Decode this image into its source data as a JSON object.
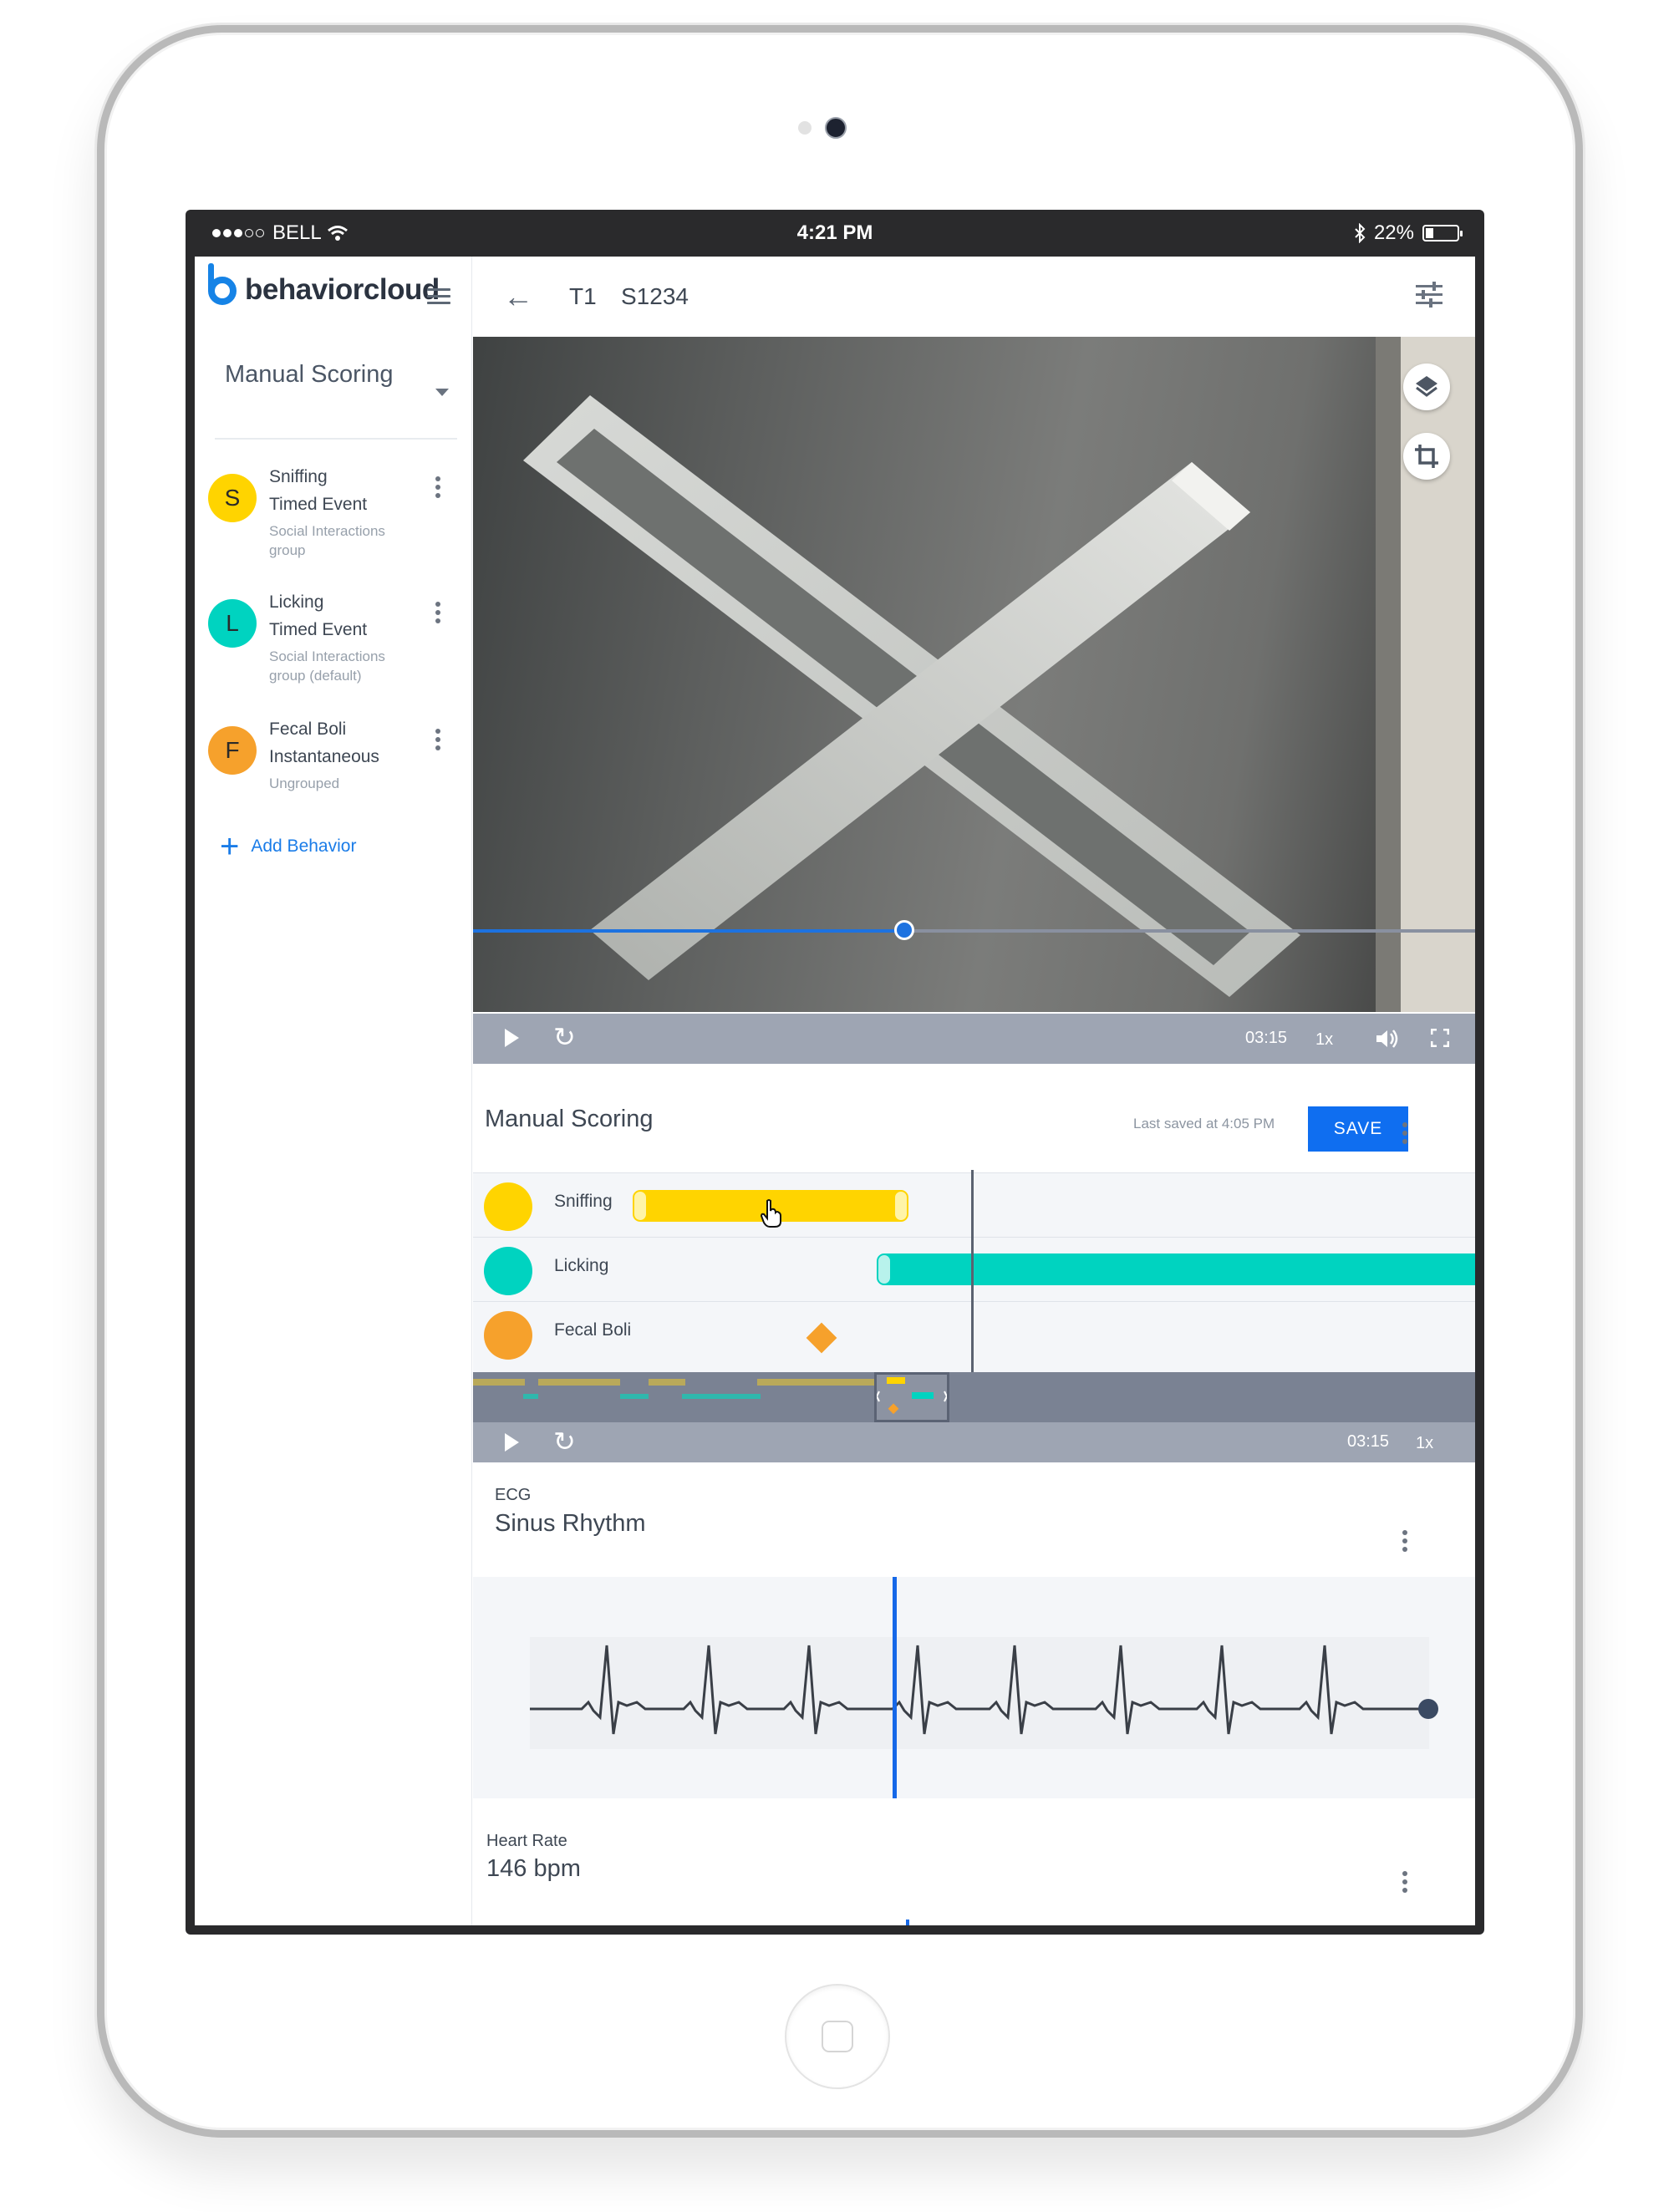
{
  "statusbar": {
    "carrier": "BELL",
    "time": "4:21 PM",
    "battery": "22%"
  },
  "sidebar": {
    "brand": "behaviorcloud",
    "section_title": "Manual Scoring",
    "behaviors": [
      {
        "initial": "S",
        "name": "Sniffing",
        "type": "Timed Event",
        "group": "Social Interactions group",
        "color": "#FFD400"
      },
      {
        "initial": "L",
        "name": "Licking",
        "type": "Timed Event",
        "group": "Social Interactions group (default)",
        "color": "#00D3C0"
      },
      {
        "initial": "F",
        "name": "Fecal Boli",
        "type": "Instantaneous",
        "group": "Ungrouped",
        "color": "#F6A12C"
      }
    ],
    "add_label": "Add Behavior"
  },
  "header": {
    "trial": "T1",
    "subject": "S1234"
  },
  "video": {
    "time": "03:15",
    "speed": "1x",
    "progress": 0.43
  },
  "scoring": {
    "title": "Manual Scoring",
    "last_saved": "Last saved at 4:05 PM",
    "save_label": "SAVE",
    "rows": [
      {
        "label": "Sniffing",
        "color": "#FFD400"
      },
      {
        "label": "Licking",
        "color": "#00D3C0"
      },
      {
        "label": "Fecal Boli",
        "color": "#F6A12C"
      }
    ],
    "time": "03:15",
    "speed": "1x"
  },
  "ecg": {
    "label": "ECG",
    "value": "Sinus Rhythm"
  },
  "heart_rate": {
    "label": "Heart Rate",
    "value": "146 bpm"
  },
  "colors": {
    "accent": "#0F6EF0",
    "brand": "#1683E6"
  }
}
